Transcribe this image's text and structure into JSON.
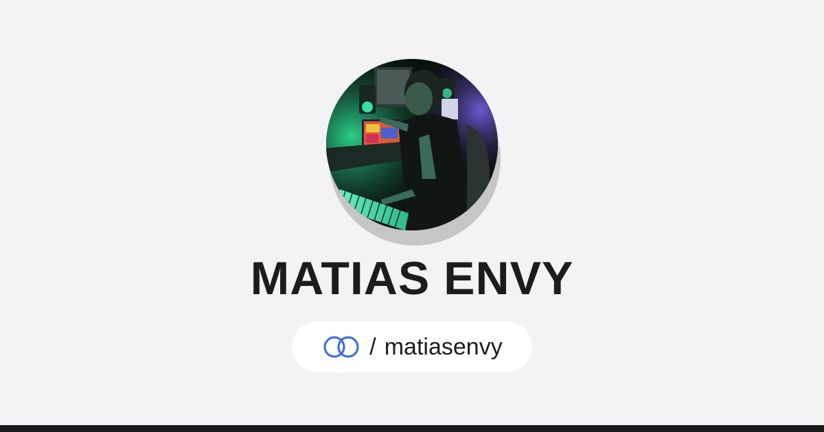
{
  "profile": {
    "name": "MATIAS ENVY",
    "avatar_alt": "Profile photo of Matias Envy in a music studio",
    "handle_prefix": "/",
    "handle": "matiasenvy"
  },
  "icons": {
    "logo": "linked-rings-icon"
  },
  "colors": {
    "background": "#f3f3f5",
    "accent": "#3f6fdc",
    "text": "#1c1c1e",
    "pill": "#ffffff",
    "bottom_bar": "#1a1a1a"
  }
}
